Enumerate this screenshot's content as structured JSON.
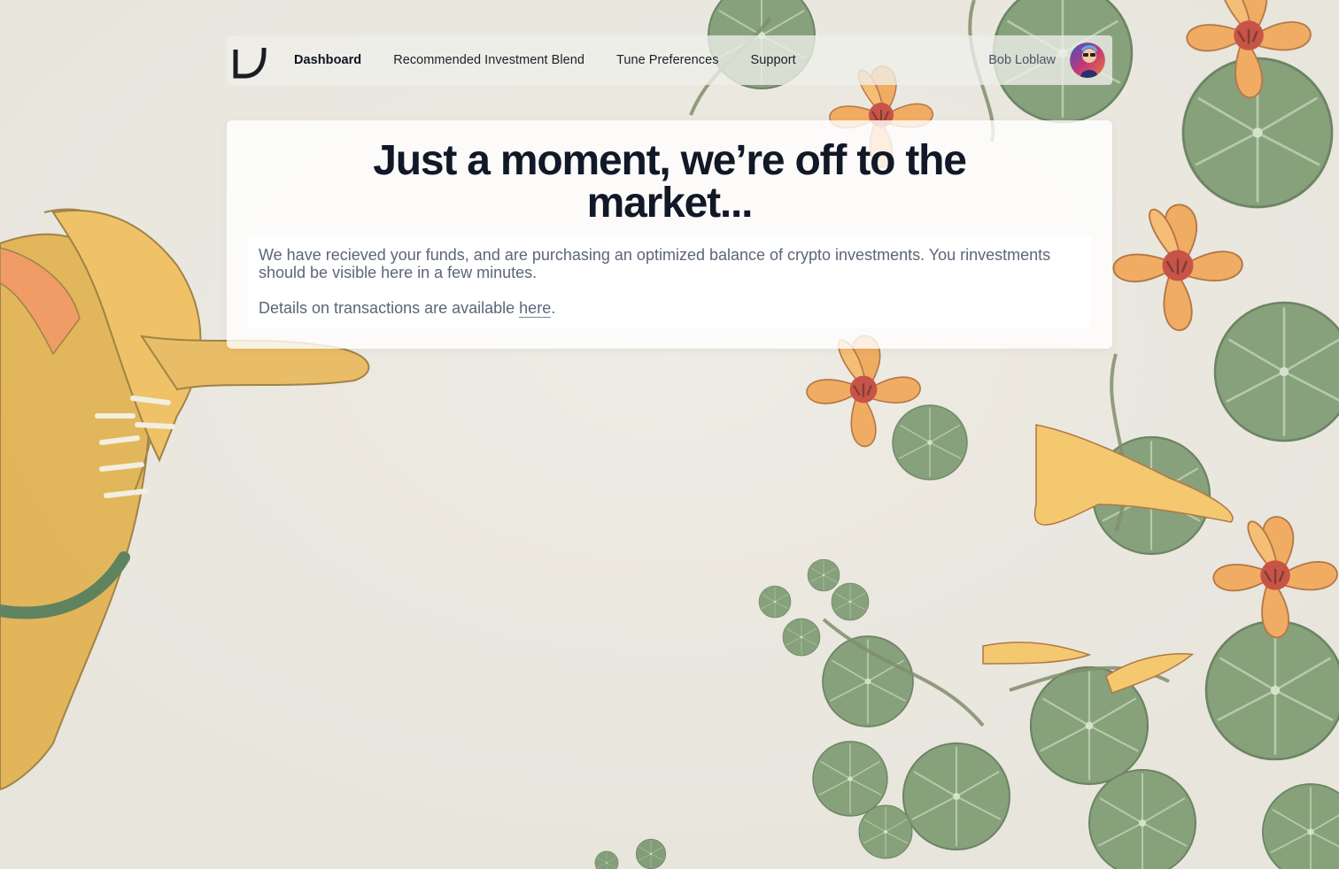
{
  "nav": {
    "items": [
      {
        "label": "Dashboard",
        "active": true
      },
      {
        "label": "Recommended Investment Blend",
        "active": false
      },
      {
        "label": "Tune Preferences",
        "active": false
      },
      {
        "label": "Support",
        "active": false
      }
    ],
    "user_name": "Bob Loblaw"
  },
  "main": {
    "headline": "Just a moment, we’re off to the market...",
    "message": "We have recieved your funds, and are purchasing an optimized balance of crypto investments. You rinvestments should be visible here in a few minutes.",
    "details_prefix": "Details on transactions are available ",
    "details_link": "here",
    "details_suffix": "."
  },
  "colors": {
    "background": "#e9e6dd",
    "headline": "#111827",
    "body_text": "#5b6678",
    "leaf_green": "#6f8f63",
    "flower_orange": "#f1a04c",
    "flower_yellow": "#f4c15a",
    "flower_red": "#c0392b"
  },
  "icons": {
    "logo": "logo-mark",
    "avatar": "user-avatar"
  }
}
